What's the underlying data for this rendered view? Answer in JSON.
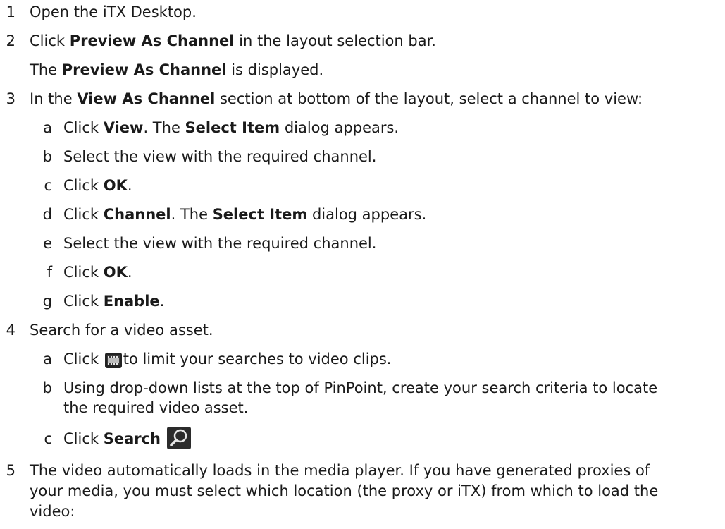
{
  "steps": [
    {
      "num": "1",
      "parts": [
        "Open the iTX Desktop."
      ]
    },
    {
      "num": "2",
      "parts": [
        "Click ",
        "Preview As Channel",
        " in the layout selection bar."
      ],
      "result": [
        "The ",
        "Preview As Channel",
        " is displayed."
      ]
    },
    {
      "num": "3",
      "parts": [
        "In the ",
        "View As Channel",
        " section at bottom of the layout, select a channel to view:"
      ],
      "substeps": [
        {
          "letter": "a",
          "parts": [
            "Click ",
            "View",
            ". The ",
            "Select Item",
            " dialog appears."
          ]
        },
        {
          "letter": "b",
          "parts": [
            "Select the view with the required channel."
          ]
        },
        {
          "letter": "c",
          "parts": [
            "Click ",
            "OK",
            "."
          ]
        },
        {
          "letter": "d",
          "parts": [
            "Click ",
            "Channel",
            ". The ",
            "Select Item",
            " dialog appears."
          ]
        },
        {
          "letter": "e",
          "parts": [
            "Select the view with the required channel."
          ]
        },
        {
          "letter": "f",
          "parts": [
            "Click ",
            "OK",
            "."
          ]
        },
        {
          "letter": "g",
          "parts": [
            "Click ",
            "Enable",
            "."
          ]
        }
      ]
    },
    {
      "num": "4",
      "parts": [
        "Search for a video asset."
      ],
      "substeps": [
        {
          "letter": "a",
          "parts": [
            "Click ",
            "to limit your searches to video clips."
          ],
          "icon": "film-icon"
        },
        {
          "letter": "b",
          "parts": [
            "Using drop-down lists at the top of PinPoint, create your search criteria to locate",
            "the required video asset."
          ]
        },
        {
          "letter": "c",
          "parts": [
            "Click ",
            "Search"
          ],
          "icon": "search-icon"
        }
      ]
    },
    {
      "num": "5",
      "parts": [
        "The video automatically loads in the media player. If you have generated proxies of",
        "your media, you must select which location (the proxy or iTX) from which to load the",
        "video:"
      ]
    }
  ]
}
